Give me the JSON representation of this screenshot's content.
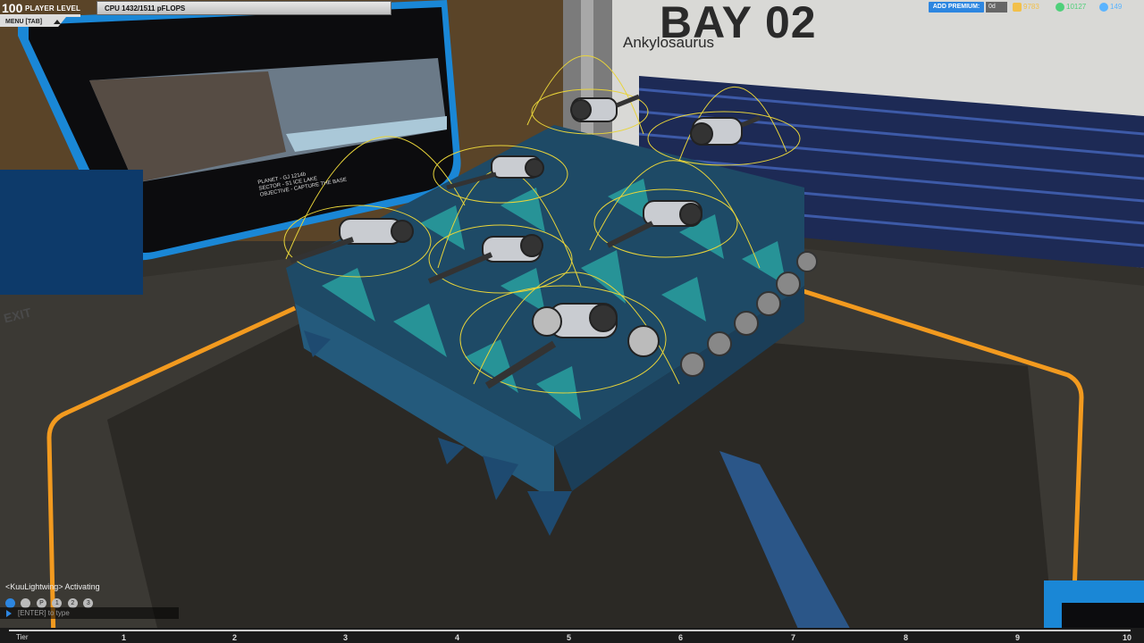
{
  "hud": {
    "player_level": "100",
    "player_level_label": "PLAYER LEVEL",
    "cpu": "CPU 1432/1511 pFLOPS",
    "menu": "MENU [TAB]",
    "add_premium": "ADD PREMIUM:",
    "premium_days": "0d",
    "robits": "9783",
    "tech_points": "10127",
    "cosmetic_credits": "149"
  },
  "garage": {
    "bay_title": "BAY 02",
    "robot_name": "Ankylosaurus",
    "exit_label": "EXIT",
    "monitor_lines": [
      "PLANET - GJ 1214b",
      "SECTOR - S1 ICE LAKE",
      "OBJECTIVE - CAPTURE THE BASE"
    ]
  },
  "chat": {
    "message": "<KuuLightwing> Activating",
    "placeholder": "[ENTER] to type",
    "channel_icons": [
      "globe",
      "ship",
      "P",
      "1",
      "2",
      "3"
    ]
  },
  "tier_bar": {
    "label": "Tier",
    "ticks": [
      "1",
      "2",
      "3",
      "4",
      "5",
      "6",
      "7",
      "8",
      "9",
      "10"
    ]
  },
  "colors": {
    "accent_blue": "#2d86e0",
    "floor_orange": "#f29a1f",
    "range_yellow": "#e8d43a",
    "armor_teal": "#2a8f98"
  }
}
